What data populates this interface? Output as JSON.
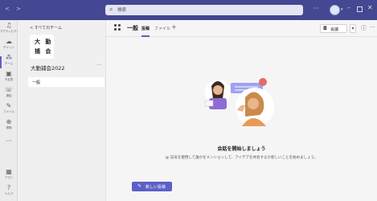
{
  "titlebar": {
    "search_placeholder": "検索",
    "more": "···"
  },
  "rail": {
    "items": [
      {
        "icon": "♫",
        "label": "アクティビティ"
      },
      {
        "icon": "☁",
        "label": "チャット"
      },
      {
        "icon": "⁂",
        "label": "チーム"
      },
      {
        "icon": "▣",
        "label": "予定表"
      },
      {
        "icon": "☏",
        "label": "通話"
      },
      {
        "icon": "✎",
        "label": "ファイル"
      },
      {
        "icon": "⊕",
        "label": "課題"
      },
      {
        "icon": "···",
        "label": ""
      },
      {
        "icon": "▦",
        "label": "アプリ"
      },
      {
        "icon": "?",
        "label": "ヘルプ"
      }
    ]
  },
  "pane": {
    "back_label": "< すべてのチーム",
    "team_tile_line1": "大 勤",
    "team_tile_line2": "捕 会",
    "team_name": "大勤捕会2022",
    "team_more": "···",
    "channel": "一般"
  },
  "main": {
    "channel_title": "一般",
    "tabs": [
      {
        "label": "投稿",
        "active": true
      },
      {
        "label": "ファイル",
        "active": false
      }
    ],
    "add_tab": "+",
    "meet_label": "会議",
    "empty_title": "会話を開始しましょう",
    "empty_desc": "@ 記号を使用して誰かをメンションして、アイデアを共有するか新しいことを始めましょう。",
    "new_post_label": "新しい投稿"
  },
  "colors": {
    "titlebar": "#444791",
    "accent": "#5b5fc7"
  }
}
